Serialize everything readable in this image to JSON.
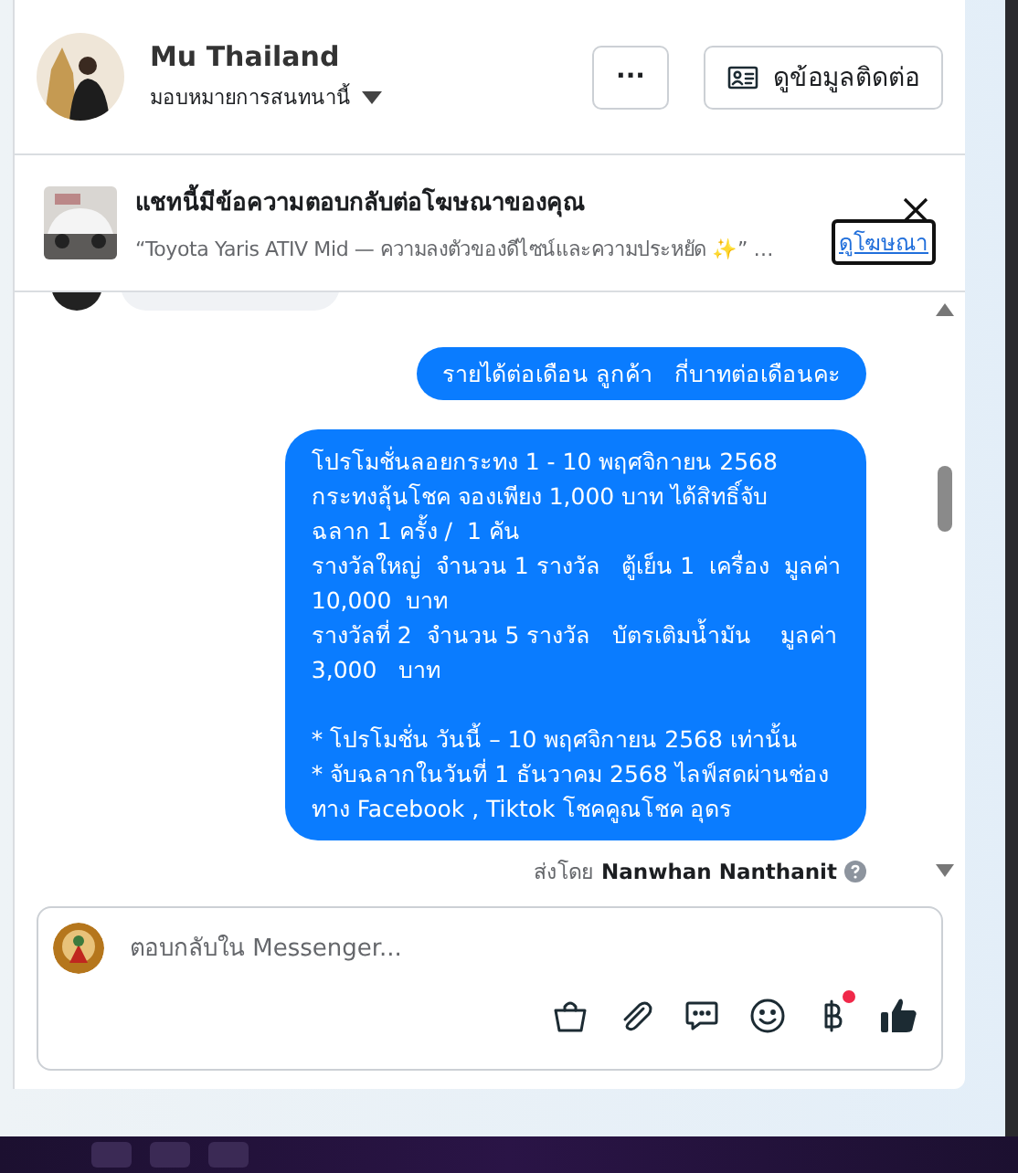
{
  "header": {
    "name": "Mu Thailand",
    "assign_label": "มอบหมายการสนทนานี้",
    "more_button": "···",
    "contact_button": "ดูข้อมูลติดต่อ"
  },
  "ad_banner": {
    "title": "แชทนี้มีข้อความตอบกลับต่อโฆษณาของคุณ",
    "snippet": "“Toyota Yaris ATIV Mid — ความลงตัวของดีไซน์และความประหยัด ✨” …",
    "link": "ดูโฆษณา"
  },
  "messages": [
    {
      "kind": "incoming_partial"
    },
    {
      "kind": "outgoing",
      "text": "รายได้ต่อเดือน ลูกค้า   กี่บาทต่อเดือนคะ"
    },
    {
      "kind": "outgoing",
      "text": "โปรโมชั่นลอยกระทง 1 - 10 พฤศจิกายน 2568\nกระทงลุ้นโชค จองเพียง 1,000 บาท ได้สิทธิ์จับ\nฉลาก 1 ครั้ง /  1 คัน\nรางวัลใหญ่  จำนวน 1 รางวัล   ตู้เย็น 1  เครื่อง  มูลค่า\n10,000  บาท\nรางวัลที่ 2  จำนวน 5 รางวัล   บัตรเติมน้ำมัน    มูลค่า\n3,000   บาท\n\n* โปรโมชั่น วันนี้ – 10 พฤศจิกายน 2568 เท่านั้น\n* จับฉลากในวันที่ 1 ธันวาคม 2568 ไลฟ์สดผ่านช่อง\nทาง Facebook , Tiktok โชคคูณโชค อุดร"
    }
  ],
  "sent_by": {
    "prefix": "ส่งโดย",
    "name": "Nanwhan Nanthanit"
  },
  "composer": {
    "placeholder": "ตอบกลับใน Messenger...",
    "payment_notification": true
  }
}
